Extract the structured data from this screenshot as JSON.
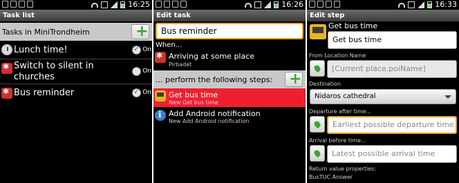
{
  "status": {
    "screen1_time": "16:25",
    "screen2_time": "16:26",
    "screen3_time": "16:33"
  },
  "screen1": {
    "title": "Task list",
    "section_label": "Tasks in MiniTrondheim",
    "tasks": [
      {
        "label": "Lunch time!",
        "icon": "clock-icon",
        "checked": true,
        "toggle_label": "On"
      },
      {
        "label": "Switch to silent in churches",
        "icon": "task-red-icon",
        "checked": false,
        "toggle_label": "On"
      },
      {
        "label": "Bus reminder",
        "icon": "task-red-icon",
        "checked": true,
        "toggle_label": "On"
      }
    ]
  },
  "screen2": {
    "title": "Edit task",
    "task_name": "Bus reminder",
    "when_label": "When...",
    "trigger": {
      "label": "Arriving at some place",
      "sub": "Pirbadet"
    },
    "steps_label": "... perform the following steps:",
    "steps": [
      {
        "label": "Get bus time",
        "sub": "New Get bus time",
        "selected": true,
        "icon": "bus-icon"
      },
      {
        "label": "Add Android notification",
        "sub": "New Add Android notification",
        "selected": false,
        "icon": "info-icon"
      }
    ],
    "selected_color": "#ee2030"
  },
  "screen3": {
    "title": "Edit step",
    "step_type": "Get bus time",
    "step_name": "Get bus time",
    "from_label": "From Location Name",
    "from_placeholder": "[Current place.poiName]",
    "destination_label": "Destination",
    "destination_value": "Nidaros cathedral",
    "departure_label": "Departure after time...",
    "departure_placeholder": "Earliest possible departure time",
    "arrival_label": "Arrival before time...",
    "arrival_placeholder": "Latest possible arrival time",
    "return_label": "Return value properties:",
    "return_value": "BusTUC Answer"
  }
}
